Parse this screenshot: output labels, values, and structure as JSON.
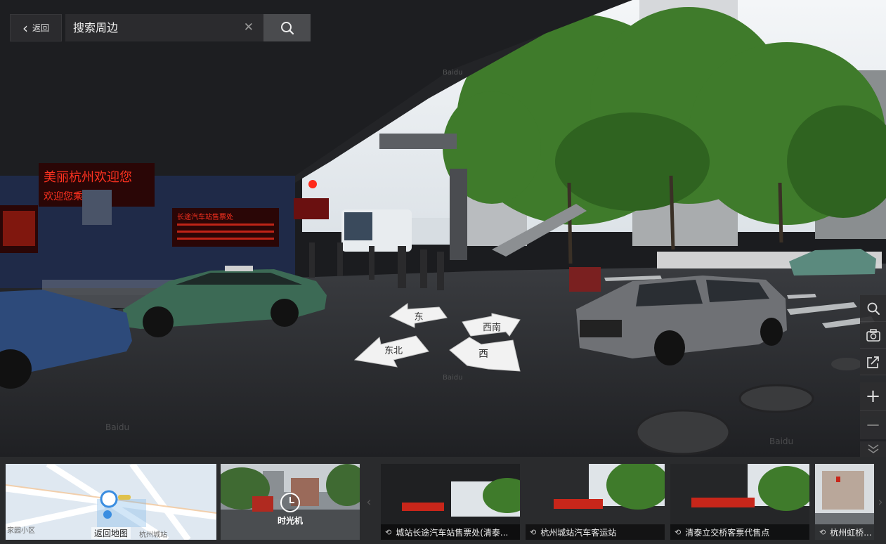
{
  "topbar": {
    "back_label": "返回",
    "search_placeholder": "搜索周边",
    "search_value": ""
  },
  "scene": {
    "signs": [
      "美丽杭州欢迎您",
      "欢迎您乘座",
      "长途汽车站售票处"
    ],
    "watermark": "Baidu",
    "nav_arrows": [
      "东",
      "西南",
      "东北",
      "西"
    ]
  },
  "side_tools": {
    "icons": [
      "search-icon",
      "camera-icon",
      "share-icon"
    ],
    "zoom_in": "+",
    "zoom_out": "−"
  },
  "filmstrip": {
    "map_thumb": {
      "label": "返回地图",
      "map_texts": [
        "家园小区",
        "杭州城站"
      ]
    },
    "time_machine": {
      "label": "时光机"
    },
    "items": [
      {
        "caption": "城站长途汽车站售票处(清泰..."
      },
      {
        "caption": "杭州城站汽车客运站"
      },
      {
        "caption": "清泰立交桥客票代售点"
      },
      {
        "caption": "杭州虹桥..."
      }
    ]
  },
  "colors": {
    "led_red": "#ff2a1a",
    "panel": "#2e2e30",
    "tree_green": "#3e7a2a",
    "sky": "#e8ecef"
  }
}
